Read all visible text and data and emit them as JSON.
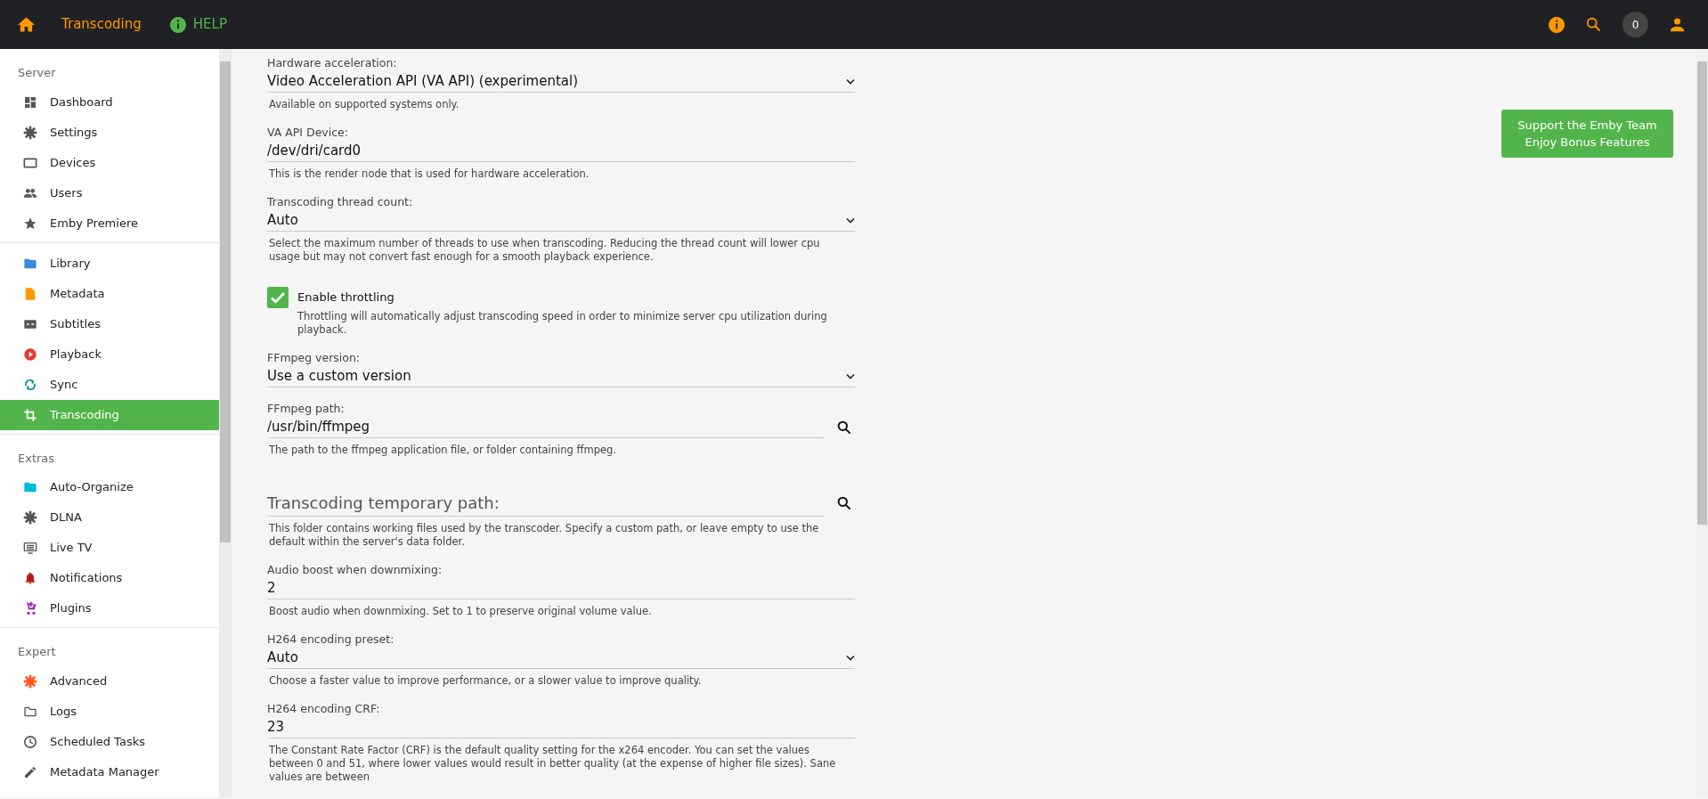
{
  "header": {
    "title": "Transcoding",
    "help": "HELP",
    "notification_count": "0"
  },
  "sidebar": {
    "sections": [
      {
        "heading": "Server",
        "items": [
          {
            "label": "Dashboard",
            "kind": "dashboard",
            "selected": false
          },
          {
            "label": "Settings",
            "kind": "gear",
            "selected": false
          },
          {
            "label": "Devices",
            "kind": "screen",
            "selected": false
          },
          {
            "label": "Users",
            "kind": "people",
            "selected": false
          },
          {
            "label": "Emby Premiere",
            "kind": "star",
            "selected": false
          }
        ]
      },
      {
        "items": [
          {
            "label": "Library",
            "kind": "folder",
            "color": "#3b8ad9",
            "selected": false
          },
          {
            "label": "Metadata",
            "kind": "file",
            "color": "#ff9800",
            "selected": false
          },
          {
            "label": "Subtitles",
            "kind": "cc",
            "selected": false
          },
          {
            "label": "Playback",
            "kind": "play",
            "color": "#e53935",
            "selected": false
          },
          {
            "label": "Sync",
            "kind": "sync",
            "color": "#009688",
            "selected": false
          },
          {
            "label": "Transcoding",
            "kind": "crop",
            "selected": true
          }
        ]
      },
      {
        "heading": "Extras",
        "items": [
          {
            "label": "Auto-Organize",
            "kind": "folder",
            "color": "#00bcd4",
            "selected": false
          },
          {
            "label": "DLNA",
            "kind": "gear",
            "selected": false
          },
          {
            "label": "Live TV",
            "kind": "tv",
            "selected": false
          },
          {
            "label": "Notifications",
            "kind": "bell",
            "color": "#b71c1c",
            "selected": false
          },
          {
            "label": "Plugins",
            "kind": "cart",
            "color": "#9c27b0",
            "selected": false
          }
        ]
      },
      {
        "heading": "Expert",
        "items": [
          {
            "label": "Advanced",
            "kind": "gear",
            "color": "#ff5722",
            "selected": false
          },
          {
            "label": "Logs",
            "kind": "folder-outline",
            "selected": false
          },
          {
            "label": "Scheduled Tasks",
            "kind": "clock",
            "selected": false
          },
          {
            "label": "Metadata Manager",
            "kind": "pencil",
            "selected": false
          }
        ]
      }
    ]
  },
  "form": {
    "fields": [
      {
        "kind": "select",
        "label": "Hardware acceleration:",
        "value": "Video Acceleration API (VA API) (experimental)",
        "description": "Available on supported systems only."
      },
      {
        "kind": "text",
        "label": "VA API Device:",
        "value": "/dev/dri/card0",
        "description": "This is the render node that is used for hardware acceleration."
      },
      {
        "kind": "select",
        "label": "Transcoding thread count:",
        "value": "Auto",
        "description": "Select the maximum number of threads to use when transcoding. Reducing the thread count will lower cpu usage but may not convert fast enough for a smooth playback experience."
      },
      {
        "kind": "checkbox",
        "label": "Enable throttling",
        "checked": true,
        "description": "Throttling will automatically adjust transcoding speed in order to minimize server cpu utilization during playback."
      },
      {
        "kind": "select",
        "label": "FFmpeg version:",
        "value": "Use a custom version"
      },
      {
        "kind": "browse",
        "label": "FFmpeg path:",
        "value": "/usr/bin/ffmpeg",
        "description": "The path to the ffmpeg application file, or folder containing ffmpeg."
      },
      {
        "kind": "browse",
        "placeholder": "Transcoding temporary path:",
        "description": "This folder contains working files used by the transcoder. Specify a custom path, or leave empty to use the default within the server's data folder."
      },
      {
        "kind": "text",
        "label": "Audio boost when downmixing:",
        "value": "2",
        "description": "Boost audio when downmixing. Set to 1 to preserve original volume value."
      },
      {
        "kind": "select",
        "label": "H264 encoding preset:",
        "value": "Auto",
        "description": "Choose a faster value to improve performance, or a slower value to improve quality."
      },
      {
        "kind": "text",
        "label": "H264 encoding CRF:",
        "value": "23",
        "description": "The Constant Rate Factor (CRF) is the default quality setting for the x264 encoder. You can set the values between 0 and 51, where lower values would result in better quality (at the expense of higher file sizes). Sane values are between"
      }
    ]
  },
  "support_button": {
    "lines": [
      "Support the Emby Team",
      "Enjoy Bonus Features"
    ]
  }
}
